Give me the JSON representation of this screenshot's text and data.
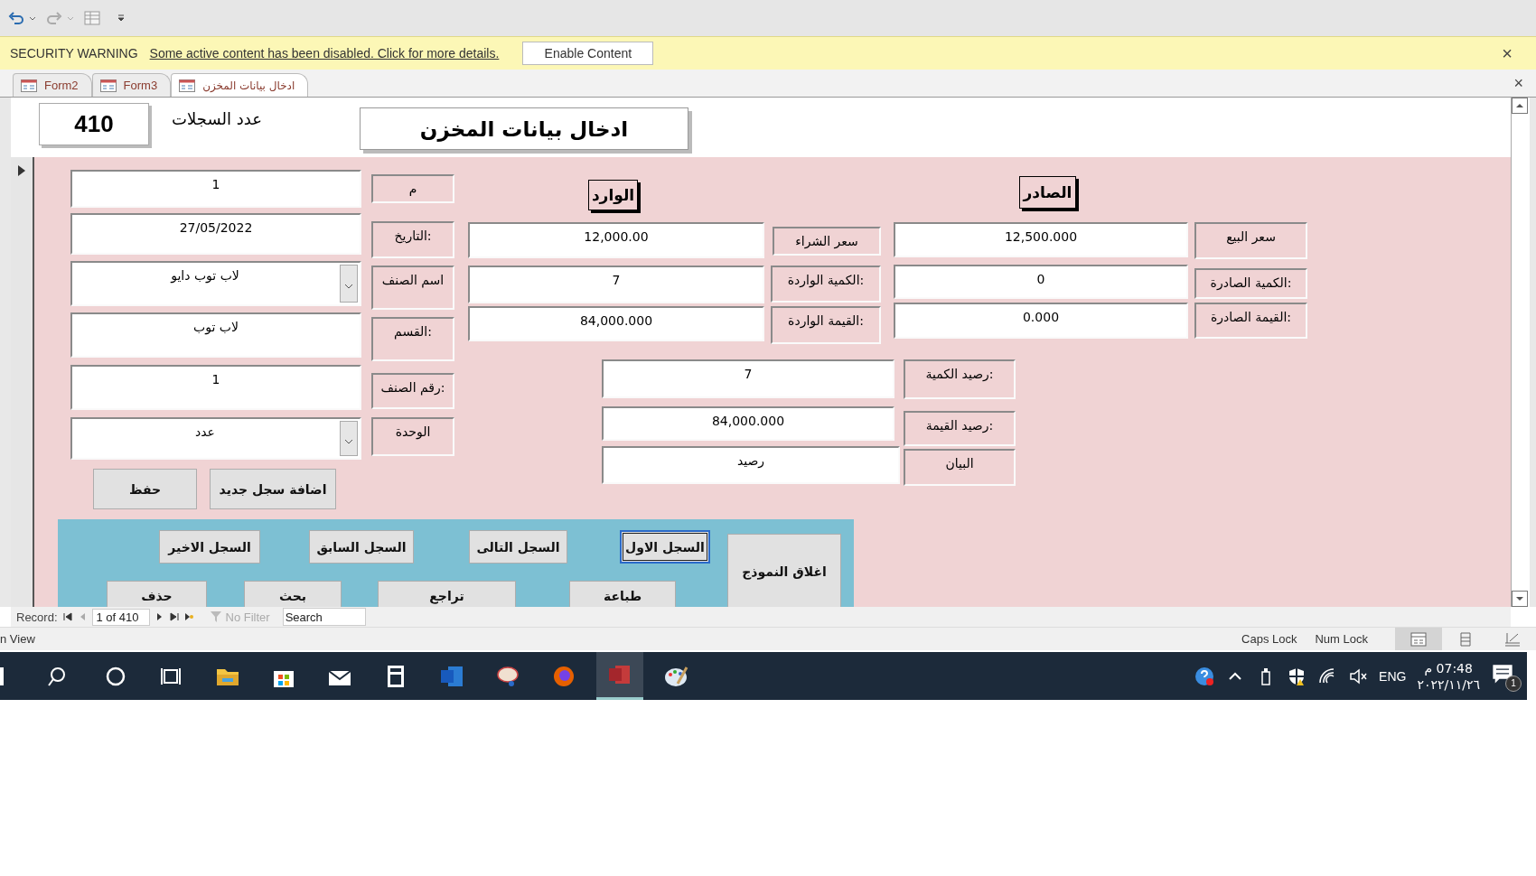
{
  "security_bar": {
    "label": "SECURITY WARNING",
    "message": "Some active content has been disabled. Click for more details.",
    "button": "Enable Content",
    "close": "×"
  },
  "document_tabs": [
    {
      "label": "ادخال بيانات المخزن",
      "selected": true
    },
    {
      "label": "Form3",
      "selected": false
    },
    {
      "label": "Form2",
      "selected": false
    }
  ],
  "tabs_close": "×",
  "form": {
    "record_count": "410",
    "record_count_label": "عدد السجلات",
    "title": "ادخال بيانات المخزن",
    "item_fields": [
      {
        "label": "م",
        "value": "1",
        "kind": "text"
      },
      {
        "label": "التاريخ:",
        "value": "27/05/2022",
        "kind": "text"
      },
      {
        "label": "اسم الصنف",
        "value": "لاب توب دايو",
        "kind": "combo"
      },
      {
        "label": "القسم:",
        "value": "لاب توب",
        "kind": "text"
      },
      {
        "label": "رقم الصنف:",
        "value": "1",
        "kind": "text"
      },
      {
        "label": "الوحدة",
        "value": "عدد",
        "kind": "combo"
      }
    ],
    "incoming_heading": "الوارد",
    "incoming_fields": [
      {
        "label": "سعر الشراء",
        "value": "12,000.00"
      },
      {
        "label": "الكمية الواردة:",
        "value": "7"
      },
      {
        "label": "القيمة الواردة:",
        "value": "84,000.000"
      }
    ],
    "outgoing_heading": "الصادر",
    "outgoing_fields": [
      {
        "label": "سعر البيع",
        "value": "12,500.000"
      },
      {
        "label": "الكمية الصادرة:",
        "value": "0"
      },
      {
        "label": "القيمة الصادرة:",
        "value": "0.000"
      }
    ],
    "balance_fields": [
      {
        "label": "رصيد الكمية:",
        "value": "7"
      },
      {
        "label": "رصيد القيمة:",
        "value": "84,000.000"
      },
      {
        "label": "البيان",
        "value": "رصيد"
      }
    ],
    "action_buttons": [
      "اضافة سجل جديد",
      "حفظ"
    ],
    "nav_buttons": [
      {
        "label": "السجل الاول",
        "selected": true
      },
      {
        "label": "السجل التالى",
        "selected": false
      },
      {
        "label": "السجل السابق",
        "selected": false
      },
      {
        "label": "السجل الاخير",
        "selected": false
      }
    ],
    "close_button": "اغلاق النموذج",
    "command_buttons": [
      "طباعة",
      "تراجع",
      "بحث",
      "حذف"
    ]
  },
  "record_navigator": {
    "label": "Record:",
    "position": "1 of 410",
    "filter": "No Filter",
    "search_placeholder": "Search"
  },
  "status_bar": {
    "view": "n View",
    "indicators": [
      "Num Lock",
      "Caps Lock"
    ]
  },
  "taskbar": {
    "language": "ENG",
    "time": "07:48 م",
    "date": "٢٠٢٢/١١/٢٦",
    "notification_count": "1"
  }
}
